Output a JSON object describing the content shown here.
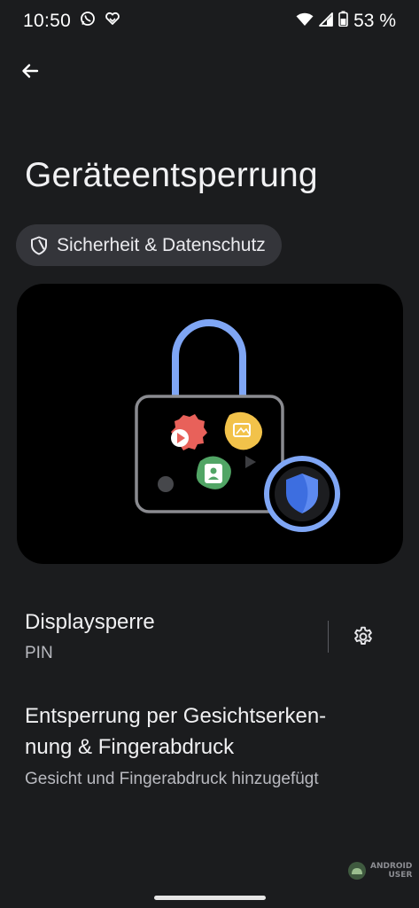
{
  "status_bar": {
    "time": "10:50",
    "battery": "53 %",
    "left_icons": [
      "whatsapp-icon",
      "heart-notification-icon"
    ],
    "right_icons": [
      "wifi-icon",
      "cell-signal-icon",
      "battery-icon"
    ]
  },
  "header": {
    "back_icon": "arrow-back-icon",
    "title": "Geräteentsperrung"
  },
  "chip": {
    "icon": "shield-icon",
    "label": "Sicherheit & Datenschutz"
  },
  "preferences": [
    {
      "title": "Displaysperre",
      "summary": "PIN",
      "action_icon": "gear-icon"
    },
    {
      "title_line1": "Entsperrung per Gesichtserken-",
      "title_line2": "nung & Fingerabdruck",
      "summary": "Gesicht und Fingerabdruck hinzugefügt"
    }
  ],
  "watermark": {
    "line1": "ANDROID",
    "line2": "USER"
  },
  "colors": {
    "background": "#1b1c1e",
    "chip": "#34353a",
    "accent_blue": "#7fa6f5",
    "shield_blue": "#3d6ee0"
  }
}
